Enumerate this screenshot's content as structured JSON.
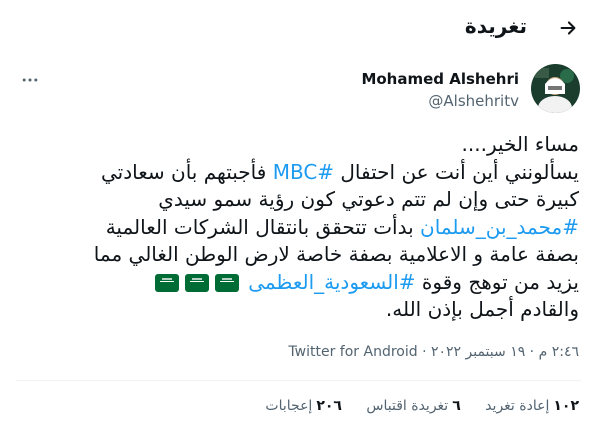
{
  "header": {
    "title": "تغريدة"
  },
  "author": {
    "name": "Mohamed Alshehri",
    "handle": "@Alshehritv"
  },
  "tweet": {
    "line1": "مساء الخير....",
    "line2_before": "يسألونني أين أنت عن احتفال ",
    "line2_hashtag": "#MBC",
    "line2_after": " فأجبتهم بأن سعادتي",
    "line3": "كبيرة حتى وإن لم تتم دعوتي كون رؤية سمو سيدي",
    "line4_hashtag": "#محمد_بن_سلمان",
    "line4_after": " بدأت تتحقق بانتقال الشركات العالمية",
    "line5": "بصفة عامة و الاعلامية بصفة خاصة لارض الوطن الغالي مما",
    "line6_before": "يزيد من توهج وقوة ",
    "line6_hashtag": "#السعودية_العظمى",
    "line7": "والقادم أجمل بإذن الله."
  },
  "meta": {
    "time": "٢:٤٦ م",
    "date": "١٩ سبتمبر ٢٠٢٢",
    "source": "Twitter for Android"
  },
  "stats": {
    "retweets_count": "١٠٢",
    "retweets_label": "إعادة تغريد",
    "quotes_count": "٦",
    "quotes_label": "تغريدة اقتباس",
    "likes_count": "٢٠٦",
    "likes_label": "إعجابات"
  },
  "colors": {
    "accent": "#1d9bf0",
    "secondary_text": "#536471",
    "flag": "#006c35"
  }
}
